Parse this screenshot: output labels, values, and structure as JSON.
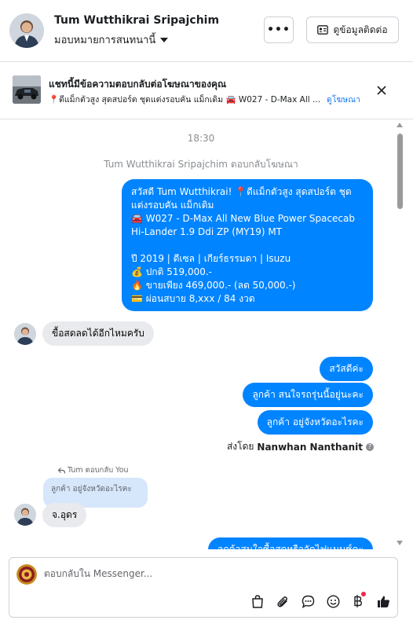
{
  "header": {
    "name": "Tum Wutthikrai Sripajchim",
    "assign_label": "มอบหมายการสนทนานี้",
    "more_label": "•••",
    "contact_button": "ดูข้อมูลติดต่อ"
  },
  "ad_banner": {
    "title": "แชทนี้มีข้อความตอบกลับต่อโฆษณาของคุณ",
    "subtitle": "📍ดีแม็กตัวสูง สุดสปอร์ต ชุดแต่งรอบคัน แม็กเดิม 🚘 W027 - D-Max All ...",
    "link_label": "ดูโฆษณา"
  },
  "chat": {
    "timestamp": "18:30",
    "ad_reply_note": "Tum Wutthikrai Sripajchim ตอบกลับโฆษณา",
    "ad_message": {
      "line1": "สวัสดี Tum Wutthikrai! 📍ดีแม็กตัวสูง สุดสปอร์ต ชุดแต่งรอบคัน แม็กเดิม",
      "line2": "🚘 W027 - D-Max All New Blue Power Spacecab Hi-Lander 1.9 Ddi ZP (MY19) MT",
      "line3": "ปี 2019 | ดีเซล | เกียร์ธรรมดา | Isuzu",
      "line4": "💰 ปกติ 519,000.-",
      "line5": "🔥 ขายเพียง 469,000.- (ลด 50,000.-)",
      "line6": "💳 ผ่อนสบาย 8,xxx / 84 งวด"
    },
    "incoming_1": "ขื้อสดลดได้อีกไหมครับ",
    "outgoing_1": "สวัสดีค่ะ",
    "outgoing_2": "ลูกค้า สนใจรถรุ่นนี้อยู่นะคะ",
    "outgoing_3": "ลูกค้า อยู่จังหวัดอะไรคะ",
    "sent_by_prefix": "ส่งโดย",
    "sent_by_name": "Nanwhan Nanthanit",
    "reply_label": "Tum ตอบกลับ You",
    "quoted_text": "ลูกค้า อยู่จังหวัดอะไรคะ",
    "incoming_2": "จ.อุดร",
    "outgoing_partial": "ลูกค้าสนใจซื้อสดหรือจัดไฟแนนซ์คะ"
  },
  "composer": {
    "placeholder": "ตอบกลับใน Messenger..."
  },
  "colors": {
    "accent": "#0084ff",
    "link": "#1877f2",
    "incoming_bubble": "#e9eaed",
    "quoted_bubble": "#d6e6fb",
    "notification_dot": "#f02849"
  },
  "icons": [
    "more-icon",
    "contact-card-icon",
    "close-icon",
    "caret-down-icon",
    "reply-arrow-icon",
    "info-icon",
    "shopping-bag-icon",
    "attachment-icon",
    "chat-bubble-icon",
    "emoji-icon",
    "baht-icon",
    "thumbs-up-icon"
  ]
}
